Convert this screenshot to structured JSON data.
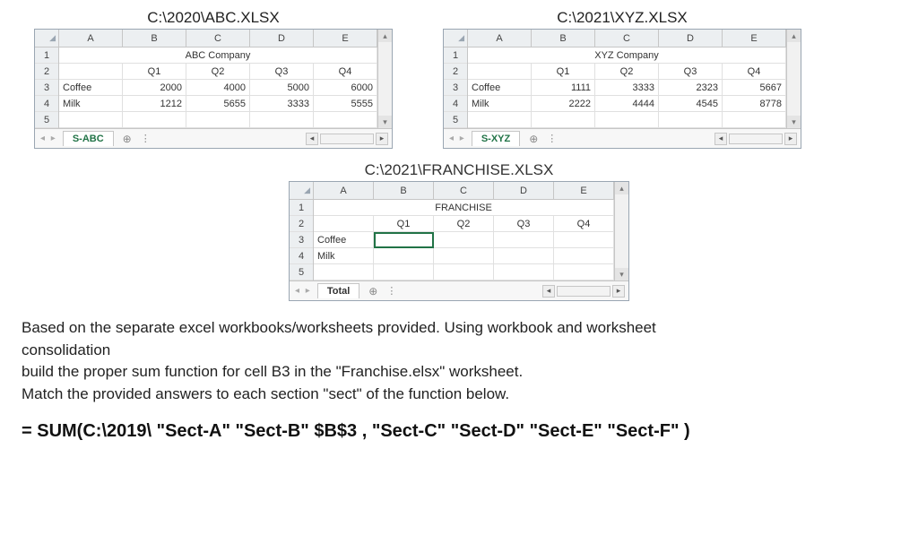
{
  "wb1": {
    "path": "C:\\2020\\ABC.XLSX",
    "cols": [
      "A",
      "B",
      "C",
      "D",
      "E"
    ],
    "rows": [
      "1",
      "2",
      "3",
      "4",
      "5"
    ],
    "title": "ABC Company",
    "hdr": [
      "",
      "Q1",
      "Q2",
      "Q3",
      "Q4"
    ],
    "r3": [
      "Coffee",
      "2000",
      "4000",
      "5000",
      "6000"
    ],
    "r4": [
      "Milk",
      "1212",
      "5655",
      "3333",
      "5555"
    ],
    "tab": "S-ABC"
  },
  "wb2": {
    "path": "C:\\2021\\XYZ.XLSX",
    "cols": [
      "A",
      "B",
      "C",
      "D",
      "E"
    ],
    "rows": [
      "1",
      "2",
      "3",
      "4",
      "5"
    ],
    "title": "XYZ Company",
    "hdr": [
      "",
      "Q1",
      "Q2",
      "Q3",
      "Q4"
    ],
    "r3": [
      "Coffee",
      "1111",
      "3333",
      "2323",
      "5667"
    ],
    "r4": [
      "Milk",
      "2222",
      "4444",
      "4545",
      "8778"
    ],
    "tab": "S-XYZ"
  },
  "wb3": {
    "path": "C:\\2021\\FRANCHISE.XLSX",
    "cols": [
      "A",
      "B",
      "C",
      "D",
      "E"
    ],
    "rows": [
      "1",
      "2",
      "3",
      "4",
      "5"
    ],
    "title": "FRANCHISE",
    "hdr": [
      "",
      "Q1",
      "Q2",
      "Q3",
      "Q4"
    ],
    "r3": [
      "Coffee",
      "",
      "",
      "",
      ""
    ],
    "r4": [
      "Milk",
      "",
      "",
      "",
      ""
    ],
    "tab": "Total"
  },
  "prose": {
    "l1": "Based on the separate excel workbooks/worksheets provided. Using workbook and worksheet consolidation",
    "l2": "build the proper sum function for cell B3 in the \"Franchise.elsx\" worksheet.",
    "l3": "Match the provided answers to each section \"sect\"  of the function below."
  },
  "formula": "= SUM(C:\\2019\\ \"Sect-A\"  \"Sect-B\"  $B$3   ,    \"Sect-C\"  \"Sect-D\"  \"Sect-E\"  \"Sect-F\" )"
}
